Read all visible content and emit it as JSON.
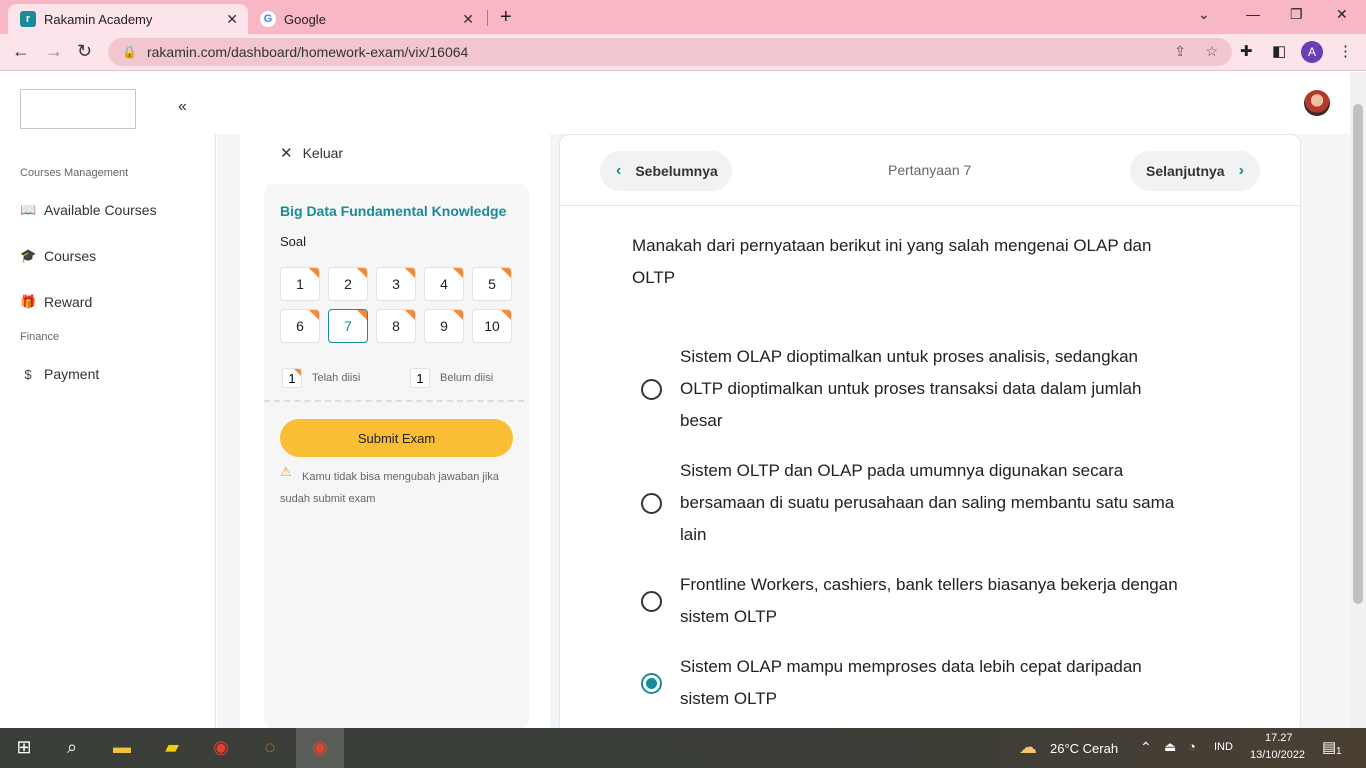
{
  "browser": {
    "tabs": [
      {
        "title": "Rakamin Academy",
        "favicon": "rakamin-logo-icon"
      },
      {
        "title": "Google",
        "favicon": "google-g-icon"
      }
    ],
    "url": "rakamin.com/dashboard/homework-exam/vix/16064",
    "profile_initial": "A"
  },
  "sidebar": {
    "sections": [
      {
        "label": "Courses Management"
      },
      {
        "label": "Finance"
      }
    ],
    "items": [
      {
        "label": "Available Courses",
        "icon": "book-icon"
      },
      {
        "label": "Courses",
        "icon": "graduation-cap-icon"
      },
      {
        "label": "Reward",
        "icon": "gift-icon"
      },
      {
        "label": "Payment",
        "icon": "dollar-icon"
      }
    ]
  },
  "exam": {
    "exit_label": "Keluar",
    "course_title": "Big Data Fundamental Knowledge",
    "soal_label": "Soal",
    "questions": [
      "1",
      "2",
      "3",
      "4",
      "5",
      "6",
      "7",
      "8",
      "9",
      "10"
    ],
    "current_question": "7",
    "legend": {
      "answered_count": "1",
      "answered_label": "Telah diisi",
      "unanswered_count": "1",
      "unanswered_label": "Belum diisi"
    },
    "submit_label": "Submit Exam",
    "warning_text": "Kamu tidak bisa mengubah jawaban jika sudah submit exam",
    "colors": {
      "accent": "#1b8a9a",
      "submit": "#f9be33",
      "marker": "#f28a3c"
    }
  },
  "question_panel": {
    "prev_label": "Sebelumnya",
    "next_label": "Selanjutnya",
    "counter": "Pertanyaan 7",
    "question_text": "Manakah dari pernyataan berikut ini yang salah mengenai OLAP dan OLTP",
    "options": [
      {
        "text": "Sistem OLAP dioptimalkan untuk proses analisis, sedangkan OLTP dioptimalkan untuk proses transaksi data dalam jumlah besar",
        "selected": false
      },
      {
        "text": "Sistem OLTP dan OLAP pada umumnya digunakan secara bersamaan di suatu perusahaan dan saling membantu satu sama lain",
        "selected": false
      },
      {
        "text": "Frontline Workers, cashiers, bank tellers biasanya bekerja dengan sistem OLTP",
        "selected": false
      },
      {
        "text": "Sistem OLAP mampu memproses data lebih cepat daripadan sistem OLTP",
        "selected": true
      }
    ]
  },
  "taskbar": {
    "weather": "26°C  Cerah",
    "language": "IND",
    "time": "17.27",
    "date": "13/10/2022",
    "notification_count": "1"
  }
}
